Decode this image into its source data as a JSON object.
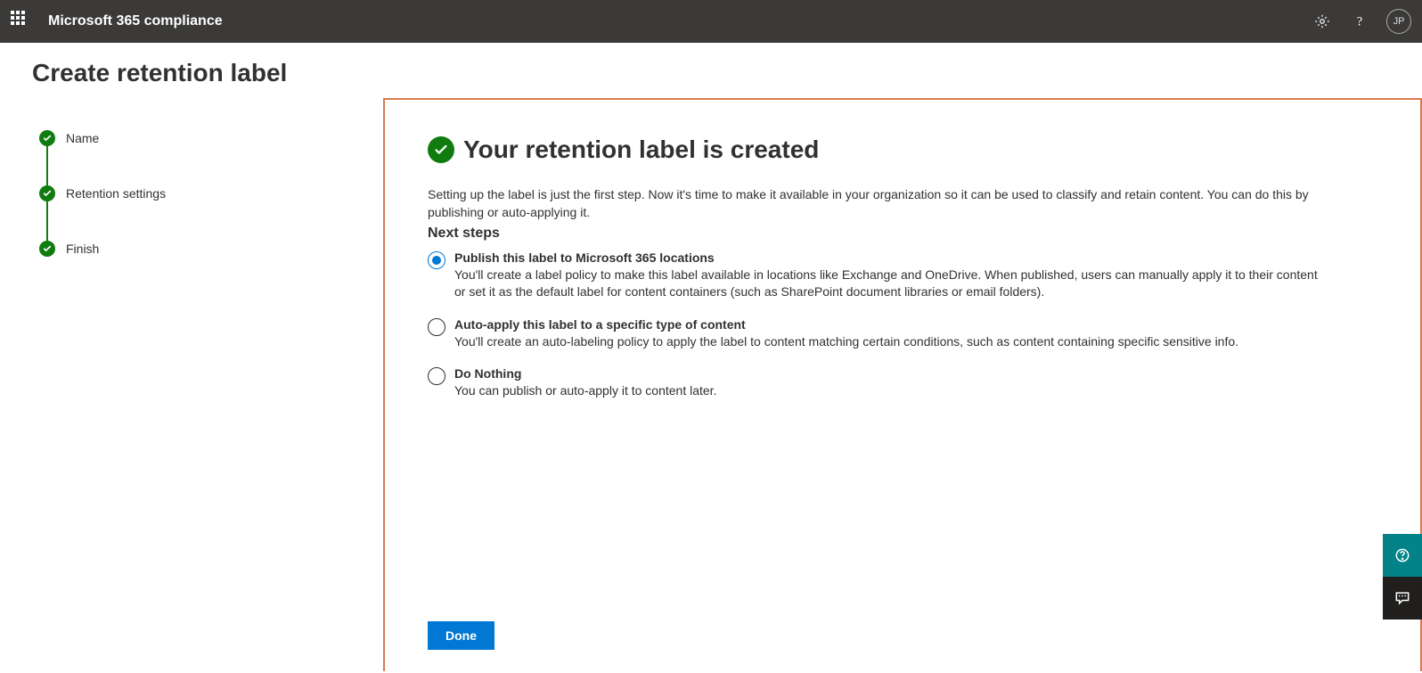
{
  "header": {
    "app_title": "Microsoft 365 compliance",
    "avatar_initials": "JP"
  },
  "page": {
    "title": "Create retention label"
  },
  "stepper": {
    "items": [
      "Name",
      "Retention settings",
      "Finish"
    ]
  },
  "main": {
    "success_title": "Your retention label is created",
    "description": "Setting up the label is just the first step. Now it's time to make it available in your organization so it can be used to classify and retain content. You can do this by publishing or auto-applying it.",
    "next_steps_label": "Next steps",
    "options": [
      {
        "title": "Publish this label to Microsoft 365 locations",
        "desc": "You'll create a label policy to make this label available in locations like Exchange and OneDrive. When published, users can manually apply it to their content or set it as the default label for content containers (such as SharePoint document libraries or email folders).",
        "selected": true
      },
      {
        "title": "Auto-apply this label to a specific type of content",
        "desc": "You'll create an auto-labeling policy to apply the label to content matching certain conditions, such as content containing specific sensitive info.",
        "selected": false
      },
      {
        "title": "Do Nothing",
        "desc": "You can publish or auto-apply it to content later.",
        "selected": false
      }
    ],
    "done_label": "Done"
  }
}
